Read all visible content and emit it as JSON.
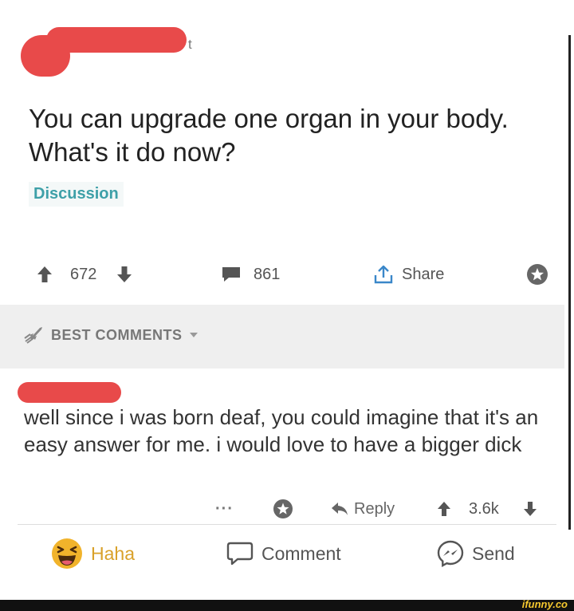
{
  "post": {
    "header_suffix": "t",
    "title": "You can upgrade one organ in your body. What's it do now?",
    "flair": "Discussion",
    "upvotes": "672",
    "comments_count": "861",
    "share_label": "Share"
  },
  "comments_section": {
    "sort_label": "BEST COMMENTS"
  },
  "comment": {
    "text": "well since i was born deaf, you could imagine that it's an easy answer for me. i would love to have a bigger dick",
    "more": "···",
    "reply_label": "Reply",
    "score": "3.6k"
  },
  "facebook": {
    "reaction_label": "Haha",
    "comment_label": "Comment",
    "send_label": "Send"
  },
  "watermark": "ifunny.co",
  "colors": {
    "redaction": "#e84a4a",
    "flair": "#3ea0a8",
    "haha": "#f1b32b"
  }
}
